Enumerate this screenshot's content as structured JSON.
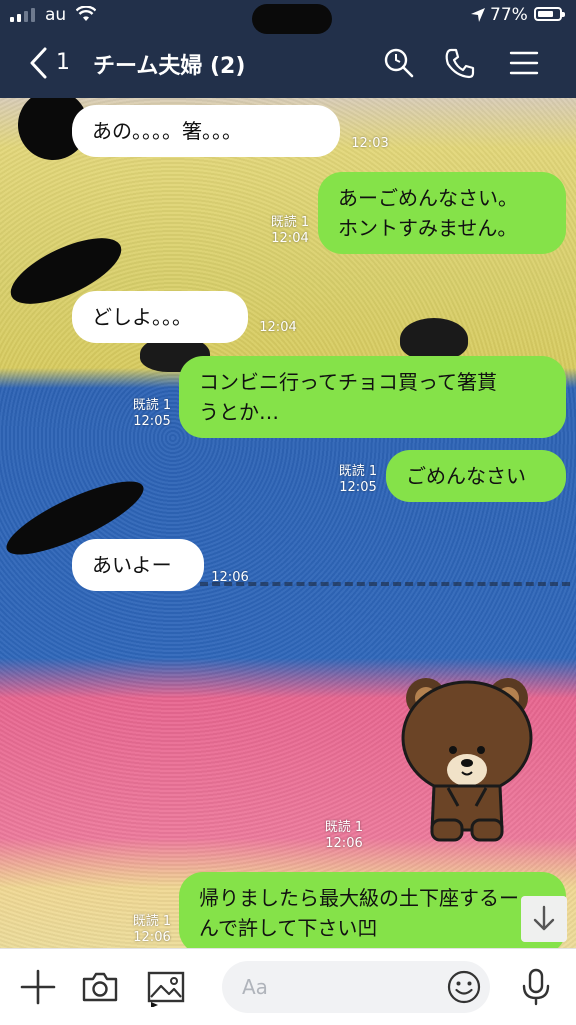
{
  "status": {
    "carrier": "au",
    "battery": "77%",
    "battery_level": 0.77
  },
  "header": {
    "back_count": "1",
    "title": "チーム夫婦 (2)"
  },
  "messages": [
    {
      "dir": "in",
      "text": "あの。。。。箸。。。",
      "time": "12:03"
    },
    {
      "dir": "out",
      "lines": [
        "あーごめんなさい。",
        "ホントすみません。"
      ],
      "read": "既読 1",
      "time": "12:04"
    },
    {
      "dir": "in",
      "text": "どしよ。。。",
      "time": "12:04"
    },
    {
      "dir": "out",
      "lines": [
        "コンビニ行ってチョコ買って箸貰",
        "うとか…"
      ],
      "read": "既読 1",
      "time": "12:05"
    },
    {
      "dir": "out",
      "text": "ごめんなさい",
      "read": "既読 1",
      "time": "12:05"
    },
    {
      "dir": "in",
      "text": "あいよー",
      "time": "12:06"
    },
    {
      "dir": "sticker",
      "name": "brown-bear-bow",
      "read": "既読 1",
      "time": "12:06"
    },
    {
      "dir": "out",
      "lines": [
        "帰りましたら最大級の土下座するー",
        "んで許して下さい凹"
      ],
      "read": "既読 1",
      "time": "12:06"
    }
  ],
  "input": {
    "placeholder": "Aa"
  },
  "icons": {
    "back": "chevron-left-icon",
    "search": "search-icon",
    "call": "phone-icon",
    "menu": "menu-icon",
    "plus": "plus-icon",
    "camera": "camera-icon",
    "image": "image-icon",
    "emoji": "emoji-icon",
    "mic": "mic-icon",
    "scroll_down": "arrow-down-icon"
  },
  "colors": {
    "header": "#22304a",
    "outgoing": "#85e249",
    "incoming": "#ffffff"
  }
}
